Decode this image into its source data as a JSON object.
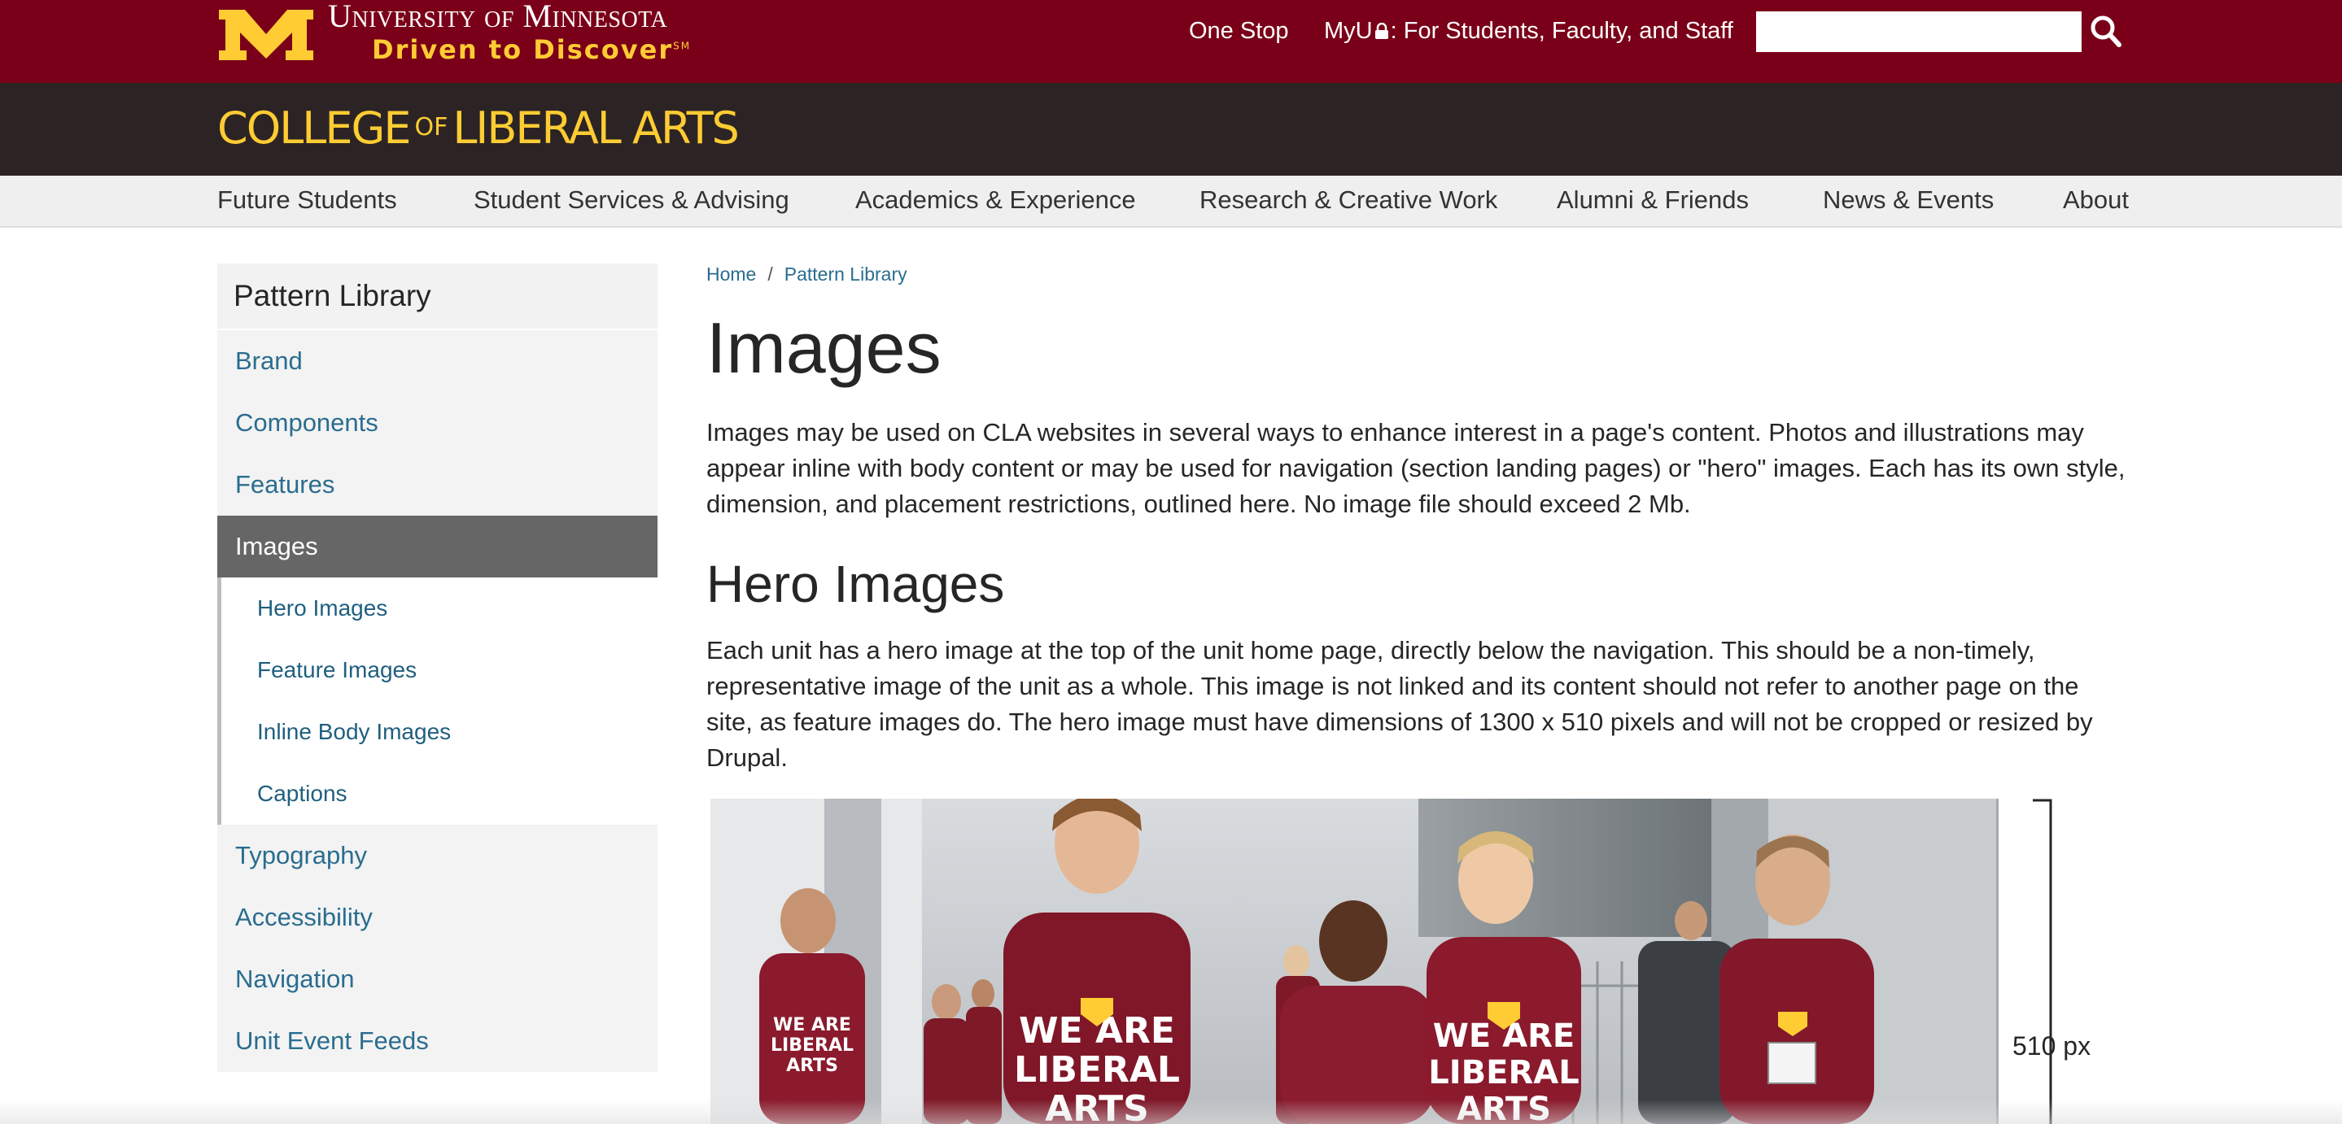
{
  "umn_header": {
    "university_name": "University of Minnesota",
    "tagline": "Driven to Discover",
    "tagline_mark": "SM",
    "links": {
      "one_stop": "One Stop",
      "myu_prefix": "MyU",
      "myu_suffix": ": For Students, Faculty, and Staff"
    },
    "search_placeholder": "",
    "search_icon": "search-icon",
    "lock_icon": "lock-icon"
  },
  "college": {
    "name_before": "COLLEGE",
    "name_of": "OF",
    "name_after": "LIBERAL ARTS"
  },
  "main_nav": [
    "Future Students",
    "Student Services & Advising",
    "Academics & Experience",
    "Research & Creative Work",
    "Alumni & Friends",
    "News & Events",
    "About"
  ],
  "sidebar": {
    "title": "Pattern Library",
    "items": [
      "Brand",
      "Components",
      "Features",
      "Images"
    ],
    "active": "Images",
    "subitems": [
      "Hero Images",
      "Feature Images",
      "Inline Body Images",
      "Captions"
    ],
    "items_after": [
      "Typography",
      "Accessibility",
      "Navigation",
      "Unit Event Feeds"
    ]
  },
  "breadcrumb": [
    "Home",
    "Pattern Library"
  ],
  "content": {
    "title": "Images",
    "intro": "Images may be used on CLA websites in several ways to enhance interest in a page's content. Photos and illustrations may appear inline with body content or may be used for navigation (section landing pages) or \"hero\" images. Each has its own style, dimension, and placement restrictions, outlined here. No image file should exceed 2 Mb.",
    "hero_heading": "Hero Images",
    "hero_text": "Each unit has a hero image at the top of the unit home page, directly below the navigation. This should be a non-timely, representative image of the unit as a whole. This image is not linked and its content should not refer to another page on the site, as feature images do. The hero image must have dimensions of 1300 x 510 pixels and will not be cropped or resized by Drupal.",
    "dimension_label": "510 px",
    "shirt_text": [
      "WE ARE",
      "LIBERAL",
      "ARTS"
    ]
  },
  "colors": {
    "maroon": "#7a0019",
    "gold": "#ffcc33",
    "dark_bar": "#2c2424",
    "link": "#2a6d8f",
    "active_gray": "#666666"
  }
}
